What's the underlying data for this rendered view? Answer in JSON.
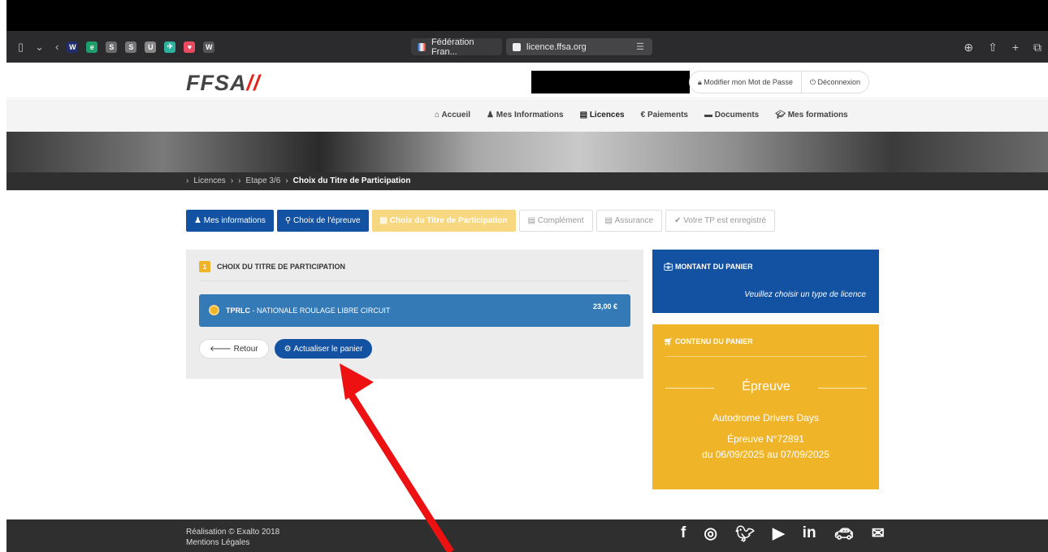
{
  "browser": {
    "tabs": [
      {
        "label": "Fédération Fran..."
      },
      {
        "label": "licence.ffsa.org"
      }
    ]
  },
  "header": {
    "logo": "FFSA",
    "change_password": "Modifier mon Mot de Passe",
    "logout": "Déconnexion"
  },
  "menu": {
    "items": [
      "Accueil",
      "Mes Informations",
      "Licences",
      "Paiements",
      "Documents",
      "Mes formations"
    ]
  },
  "breadcrumb": {
    "items": [
      "Licences",
      "Etape 3/6",
      "Choix du Titre de Participation"
    ]
  },
  "steps": [
    {
      "label": "Mes informations"
    },
    {
      "label": "Choix de l'épreuve"
    },
    {
      "label": "Choix du Titre de Participation"
    },
    {
      "label": "Complément"
    },
    {
      "label": "Assurance"
    },
    {
      "label": "Votre TP est enregistré"
    }
  ],
  "panel": {
    "step_number": "1",
    "title": "CHOIX DU TITRE DE PARTICIPATION",
    "option_code": "TPRLC",
    "option_label": " - NATIONALE ROULAGE LIBRE CIRCUIT",
    "option_price": "23,00 €",
    "back_button": "Retour",
    "update_button": "Actualiser le panier"
  },
  "cart_amount": {
    "title": "MONTANT DU PANIER",
    "message": "Veuillez choisir un type de licence"
  },
  "cart_content": {
    "title": "CONTENU DU PANIER",
    "heading": "Épreuve",
    "event_name": "Autodrome Drivers Days",
    "event_number": "Épreuve N°72891",
    "event_dates": "du 06/09/2025 au 07/09/2025"
  },
  "footer": {
    "credit": "Réalisation © Exalto 2018",
    "legal": "Mentions Légales"
  },
  "colors": {
    "primary_blue": "#1352a2",
    "option_blue": "#337ab7",
    "accent_yellow": "#f0b429",
    "arrow_red": "#ee1111"
  }
}
